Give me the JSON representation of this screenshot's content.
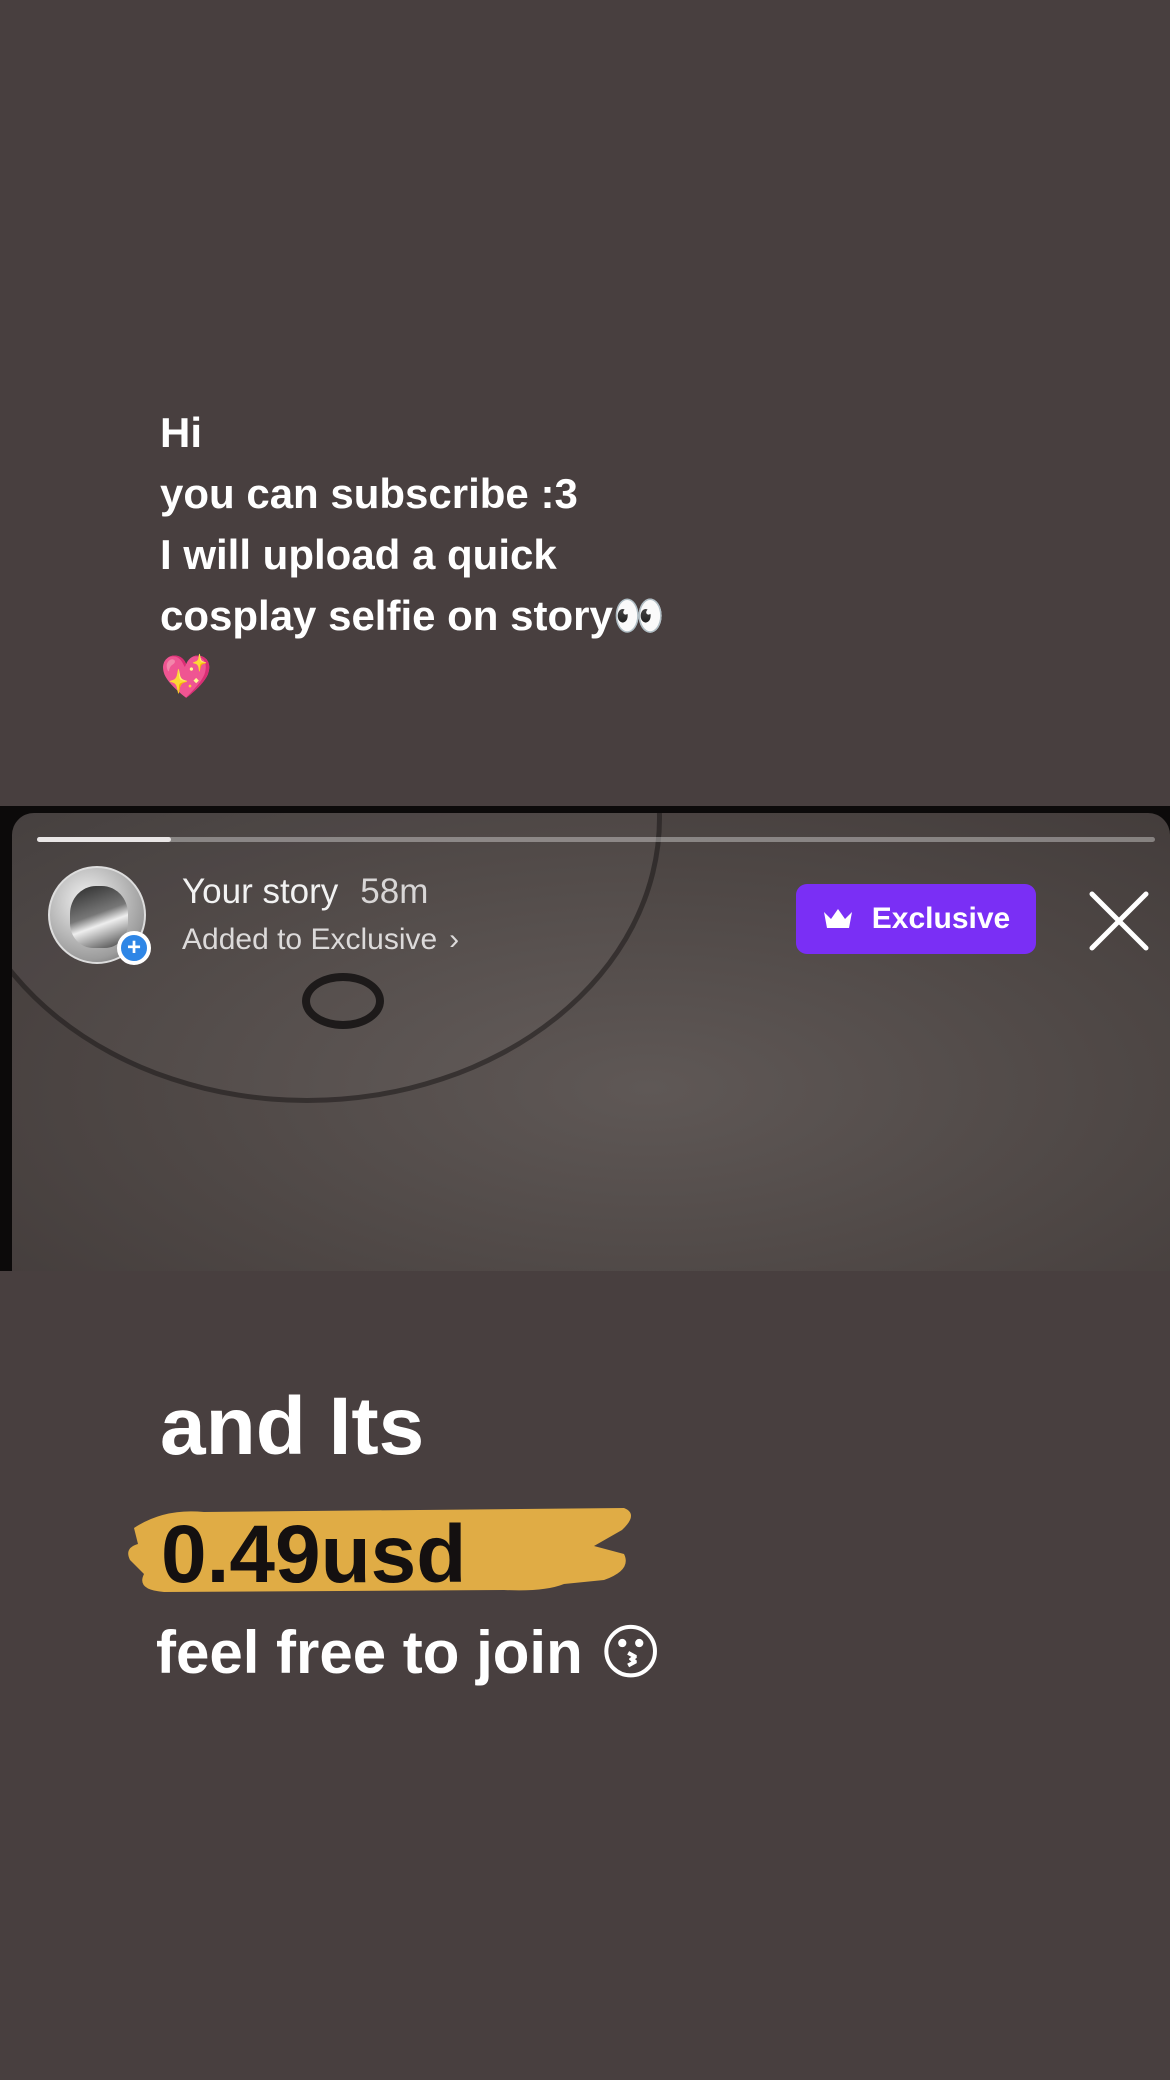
{
  "top_caption": {
    "lines": [
      "Hi",
      "you can subscribe :3",
      "I will upload a quick",
      "cosplay selfie on story👀",
      "💖"
    ]
  },
  "story": {
    "progress": 0.12,
    "user_label": "Your story",
    "time_ago": "58m",
    "added_to_prefix": "Added to",
    "added_to_name": "Exclusive",
    "exclusive_button": "Exclusive",
    "icons": [
      "avatar",
      "add-icon",
      "chevron-right-icon",
      "crown-icon",
      "close-icon"
    ]
  },
  "bottom_caption": {
    "line1": "and Its",
    "price": "0.49usd",
    "line3_text": "feel free to join",
    "line3_emoji": "😗"
  },
  "colors": {
    "background": "#483f3f",
    "exclusive_purple": "#7a2ff5",
    "price_highlight": "#e0ac45",
    "badge_blue": "#2e86e6"
  }
}
